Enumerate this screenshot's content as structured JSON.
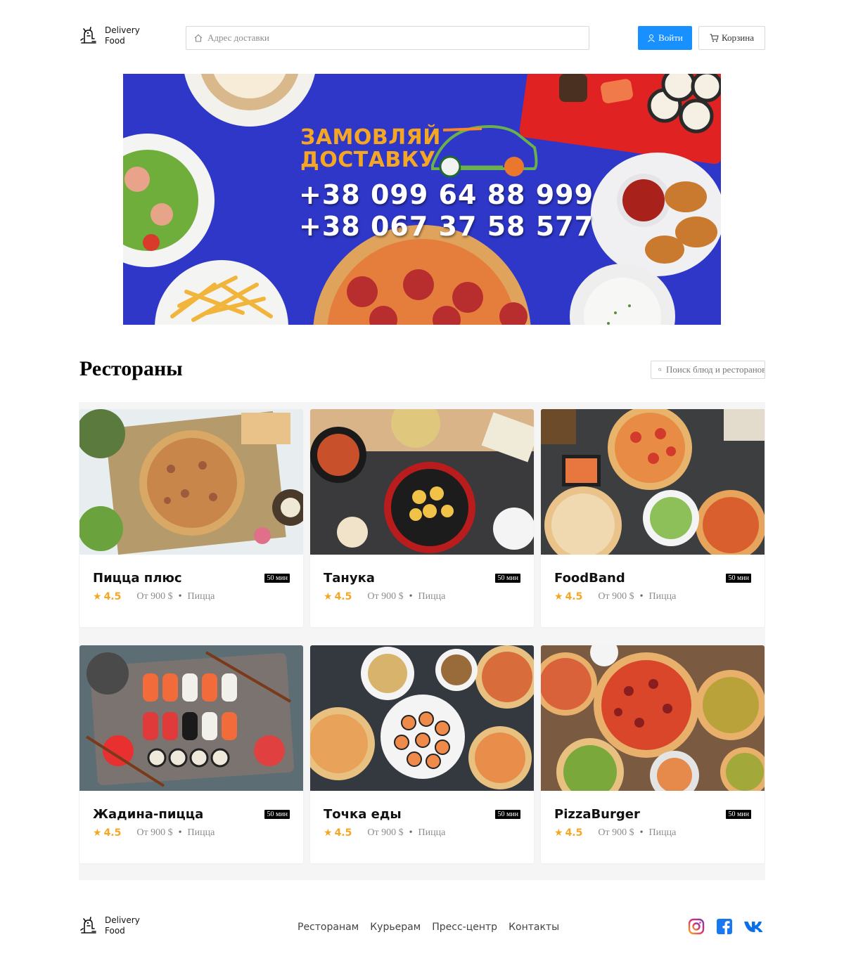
{
  "header": {
    "logo_line1": "Delivery",
    "logo_line2": "Food",
    "address_placeholder": "Адрес доставки",
    "login_label": "Войти",
    "cart_label": "Корзина"
  },
  "banner": {
    "title_line1": "ЗАМОВЛЯЙ",
    "title_line2": "ДОСТАВКУ",
    "phone1": "+38 099 64 88 999",
    "phone2": "+38 067 37 58 577"
  },
  "restaurants_section": {
    "title": "Рестораны",
    "search_placeholder": "Поиск блюд и ресторанов"
  },
  "cards": [
    {
      "name": "Пицца плюс",
      "time": "50 мин",
      "rating": "4.5",
      "price": "От 900 $",
      "category": "Пицца"
    },
    {
      "name": "Танука",
      "time": "50 мин",
      "rating": "4.5",
      "price": "От 900 $",
      "category": "Пицца"
    },
    {
      "name": "FoodBand",
      "time": "50 мин",
      "rating": "4.5",
      "price": "От 900 $",
      "category": "Пицца"
    },
    {
      "name": "Жадина-пицца",
      "time": "50 мин",
      "rating": "4.5",
      "price": "От 900 $",
      "category": "Пицца"
    },
    {
      "name": "Точка еды",
      "time": "50 мин",
      "rating": "4.5",
      "price": "От 900 $",
      "category": "Пицца"
    },
    {
      "name": "PizzaBurger",
      "time": "50 мин",
      "rating": "4.5",
      "price": "От 900 $",
      "category": "Пицца"
    }
  ],
  "footer": {
    "logo_line1": "Delivery",
    "logo_line2": "Food",
    "nav": [
      "Ресторанам",
      "Курьерам",
      "Пресс-центр",
      "Контакты"
    ]
  },
  "colors": {
    "primary": "#1890ff",
    "rating": "#f5a623",
    "banner_bg": "#2e37c8",
    "banner_title": "#f5a623"
  },
  "icons": {
    "header": [
      "home-icon",
      "user-icon",
      "cart-icon"
    ],
    "search": "search-icon",
    "rating": "star-icon",
    "social": [
      "instagram-icon",
      "facebook-icon",
      "vk-icon"
    ]
  }
}
